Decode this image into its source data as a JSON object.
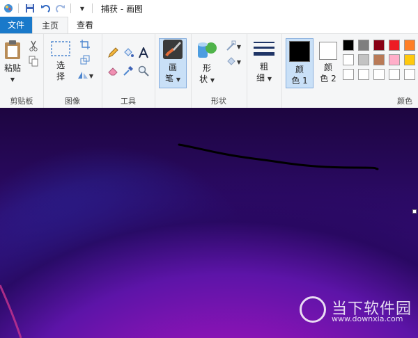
{
  "window": {
    "title": "捕获 - 画图"
  },
  "tabs": [
    {
      "label": "文件"
    },
    {
      "label": "主页"
    },
    {
      "label": "查看"
    }
  ],
  "ribbon": {
    "clipboard": {
      "label": "剪贴板",
      "paste_label": "粘贴"
    },
    "image": {
      "label": "图像",
      "select_label_1": "选",
      "select_label_2": "择"
    },
    "tools": {
      "label": "工具"
    },
    "brushes": {
      "label_1": "画",
      "label_2": "笔"
    },
    "shapes": {
      "label": "形状",
      "btn_label_1": "形",
      "btn_label_2": "状"
    },
    "size": {
      "label_1": "粗",
      "label_2": "细"
    },
    "color1": {
      "label_1": "颜",
      "label_2": "色 1",
      "value": "#000000"
    },
    "color2": {
      "label_1": "颜",
      "label_2": "色 2",
      "value": "#ffffff"
    },
    "colors": {
      "label": "颜色",
      "row1": [
        "#000000",
        "#7f7f7f",
        "#880015",
        "#ed1c24",
        "#ff7f27"
      ],
      "row2": [
        "#ffffff",
        "#c3c3c3",
        "#b97a57",
        "#ffaec9",
        "#ffc90e"
      ],
      "row3": [
        "#ffffff",
        "#ffffff",
        "#ffffff",
        "#ffffff",
        "#ffffff"
      ]
    }
  },
  "watermark": {
    "name": "当下软件园",
    "url": "www.downxia.com"
  }
}
